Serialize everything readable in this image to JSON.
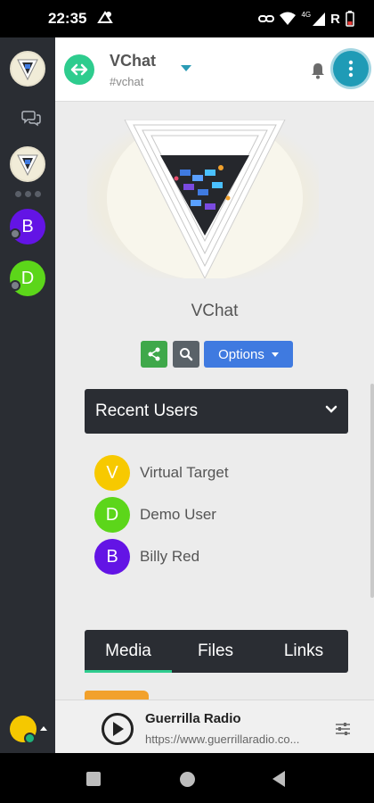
{
  "status_bar": {
    "time": "22:35",
    "network": "4G",
    "signal_extra": "R"
  },
  "sidebar": {
    "servers": [
      {
        "letter": "B",
        "color": "#6314e5"
      },
      {
        "letter": "D",
        "color": "#5cd61a"
      }
    ],
    "user_color": "#f5c800"
  },
  "header": {
    "title": "VChat",
    "subtitle": "#vchat"
  },
  "channel": {
    "name": "VChat"
  },
  "actions": {
    "options_label": "Options"
  },
  "recent_users": {
    "title": "Recent Users",
    "users": [
      {
        "letter": "V",
        "name": "Virtual Target",
        "color": "#f7c900"
      },
      {
        "letter": "D",
        "name": "Demo User",
        "color": "#5cd61a"
      },
      {
        "letter": "B",
        "name": "Billy Red",
        "color": "#6314e5"
      }
    ]
  },
  "tabs": {
    "media": "Media",
    "files": "Files",
    "links": "Links",
    "active": "media"
  },
  "player": {
    "title": "Guerrilla Radio",
    "url": "https://www.guerrillaradio.co..."
  },
  "colors": {
    "accent": "#2ecc8e",
    "primary": "#3f7ae0",
    "share": "#3fa84a",
    "dark": "#2a2d33",
    "menu": "#1f9bb6"
  }
}
